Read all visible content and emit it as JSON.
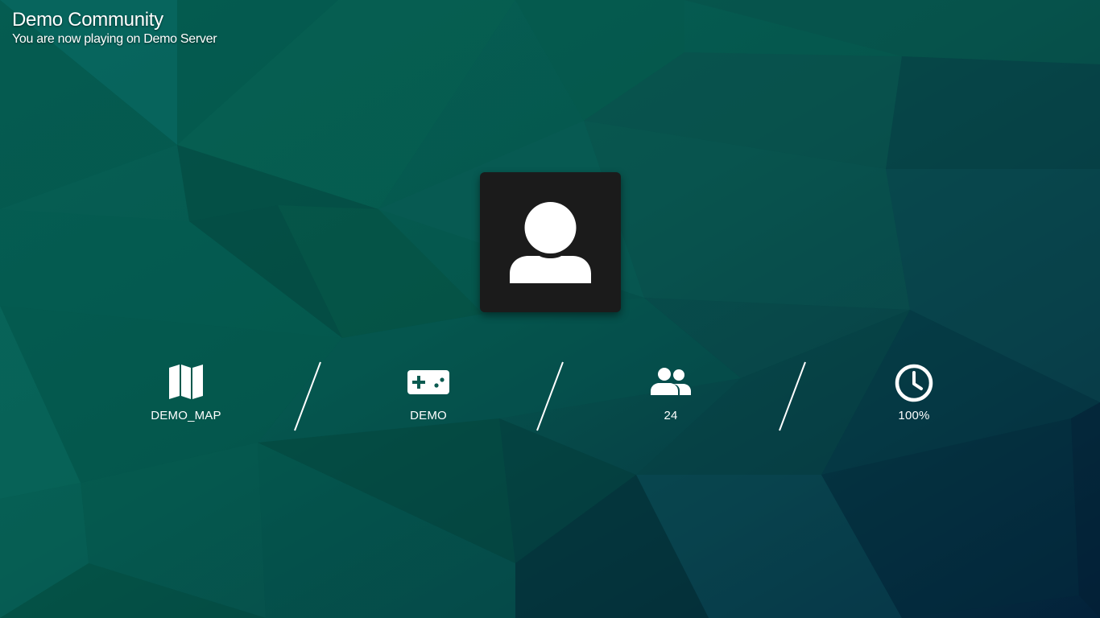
{
  "header": {
    "title": "Demo Community",
    "subtitle": "You are now playing on Demo Server"
  },
  "avatar": {
    "icon": "user-icon"
  },
  "info": [
    {
      "icon": "map-icon",
      "label": "DEMO_MAP"
    },
    {
      "icon": "gamepad-icon",
      "label": "DEMO"
    },
    {
      "icon": "users-icon",
      "label": "24"
    },
    {
      "icon": "clock-icon",
      "label": "100%"
    }
  ],
  "colors": {
    "background_primary": "#065c52",
    "background_dark": "#03253a",
    "avatar_box": "#1b1b1b",
    "text": "#ffffff"
  }
}
